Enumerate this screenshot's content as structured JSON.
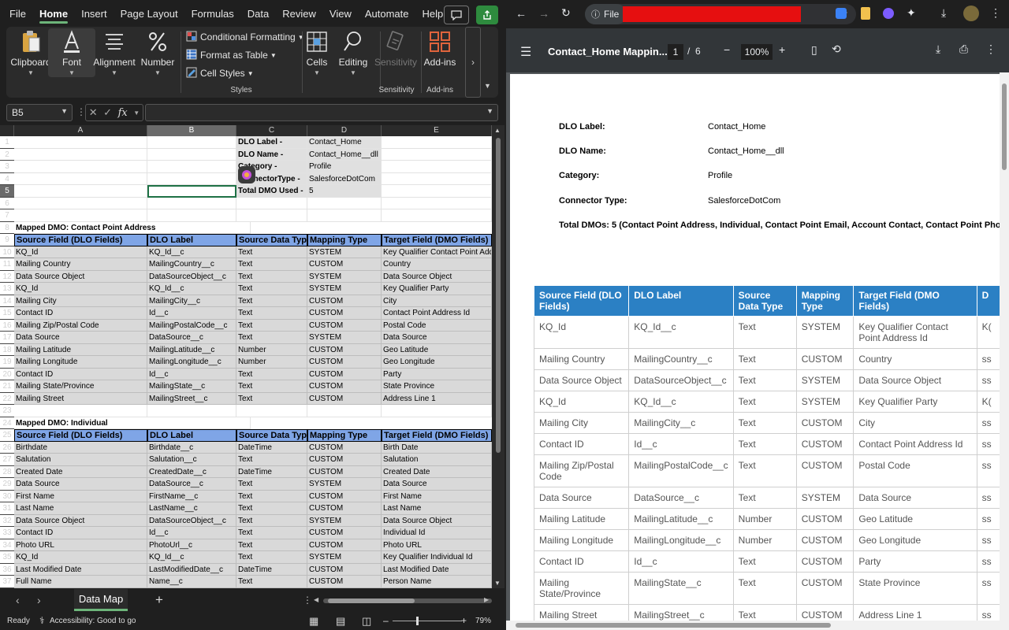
{
  "excel": {
    "tabs": [
      "File",
      "Home",
      "Insert",
      "Page Layout",
      "Formulas",
      "Data",
      "Review",
      "View",
      "Automate",
      "Help"
    ],
    "active_tab": "Home",
    "ribbon": {
      "clipboard": "Clipboard",
      "font": "Font",
      "alignment": "Alignment",
      "number": "Number",
      "conditional_formatting": "Conditional Formatting",
      "format_as_table": "Format as Table",
      "cell_styles": "Cell Styles",
      "styles_group": "Styles",
      "cells": "Cells",
      "editing": "Editing",
      "sensitivity": "Sensitivity",
      "sensitivity_group": "Sensitivity",
      "add_ins": "Add-ins",
      "add_ins_group": "Add-ins"
    },
    "name_box": "B5",
    "fx": "fx",
    "columns": [
      "A",
      "B",
      "C",
      "D",
      "E"
    ],
    "meta": [
      {
        "label": "DLO Label -",
        "value": "Contact_Home"
      },
      {
        "label": "DLO Name -",
        "value": "Contact_Home__dll"
      },
      {
        "label": "Category -",
        "value": "Profile"
      },
      {
        "label": "ConnectorType -",
        "value": "SalesforceDotCom"
      },
      {
        "label": "Total DMO Used -",
        "value": "5"
      }
    ],
    "section1_title": "Mapped DMO: Contact Point Address",
    "section2_title": "Mapped DMO: Individual",
    "table_headers": [
      "Source Field (DLO Fields)",
      "DLO Label",
      "Source Data Type",
      "Mapping Type",
      "Target Field (DMO Fields)"
    ],
    "section1_rows": [
      [
        "KQ_Id",
        "KQ_Id__c",
        "Text",
        "SYSTEM",
        "Key Qualifier Contact Point Address Id"
      ],
      [
        "Mailing Country",
        "MailingCountry__c",
        "Text",
        "CUSTOM",
        "Country"
      ],
      [
        "Data Source Object",
        "DataSourceObject__c",
        "Text",
        "SYSTEM",
        "Data Source Object"
      ],
      [
        "KQ_Id",
        "KQ_Id__c",
        "Text",
        "SYSTEM",
        "Key Qualifier Party"
      ],
      [
        "Mailing City",
        "MailingCity__c",
        "Text",
        "CUSTOM",
        "City"
      ],
      [
        "Contact ID",
        "Id__c",
        "Text",
        "CUSTOM",
        "Contact Point Address Id"
      ],
      [
        "Mailing Zip/Postal Code",
        "MailingPostalCode__c",
        "Text",
        "CUSTOM",
        "Postal Code"
      ],
      [
        "Data Source",
        "DataSource__c",
        "Text",
        "SYSTEM",
        "Data Source"
      ],
      [
        "Mailing Latitude",
        "MailingLatitude__c",
        "Number",
        "CUSTOM",
        "Geo Latitude"
      ],
      [
        "Mailing Longitude",
        "MailingLongitude__c",
        "Number",
        "CUSTOM",
        "Geo Longitude"
      ],
      [
        "Contact ID",
        "Id__c",
        "Text",
        "CUSTOM",
        "Party"
      ],
      [
        "Mailing State/Province",
        "MailingState__c",
        "Text",
        "CUSTOM",
        "State Province"
      ],
      [
        "Mailing Street",
        "MailingStreet__c",
        "Text",
        "CUSTOM",
        "Address Line 1"
      ]
    ],
    "section2_rows": [
      [
        "Birthdate",
        "Birthdate__c",
        "DateTime",
        "CUSTOM",
        "Birth Date"
      ],
      [
        "Salutation",
        "Salutation__c",
        "Text",
        "CUSTOM",
        "Salutation"
      ],
      [
        "Created Date",
        "CreatedDate__c",
        "DateTime",
        "CUSTOM",
        "Created Date"
      ],
      [
        "Data Source",
        "DataSource__c",
        "Text",
        "SYSTEM",
        "Data Source"
      ],
      [
        "First Name",
        "FirstName__c",
        "Text",
        "CUSTOM",
        "First Name"
      ],
      [
        "Last Name",
        "LastName__c",
        "Text",
        "CUSTOM",
        "Last Name"
      ],
      [
        "Data Source Object",
        "DataSourceObject__c",
        "Text",
        "SYSTEM",
        "Data Source Object"
      ],
      [
        "Contact ID",
        "Id__c",
        "Text",
        "CUSTOM",
        "Individual Id"
      ],
      [
        "Photo URL",
        "PhotoUrl__c",
        "Text",
        "CUSTOM",
        "Photo URL"
      ],
      [
        "KQ_Id",
        "KQ_Id__c",
        "Text",
        "SYSTEM",
        "Key Qualifier Individual Id"
      ],
      [
        "Last Modified Date",
        "LastModifiedDate__c",
        "DateTime",
        "CUSTOM",
        "Last Modified Date"
      ],
      [
        "Full Name",
        "Name__c",
        "Text",
        "CUSTOM",
        "Person Name"
      ]
    ],
    "sheet_tab": "Data Map",
    "status": {
      "ready": "Ready",
      "accessibility": "Accessibility: Good to go",
      "zoom": "79%"
    }
  },
  "browser": {
    "address_chip": "File",
    "pdf_title": "Contact_Home Mappin...",
    "page_current": "1",
    "page_sep": "/",
    "page_total": "6",
    "zoom": "100%",
    "meta": [
      {
        "label": "DLO Label:",
        "value": "Contact_Home"
      },
      {
        "label": "DLO Name:",
        "value": "Contact_Home__dll"
      },
      {
        "label": "Category:",
        "value": "Profile"
      },
      {
        "label": "Connector Type:",
        "value": "SalesforceDotCom"
      }
    ],
    "total_dmos": "Total DMOs: 5 (Contact Point Address, Individual, Contact Point Email, Account Contact, Contact Point Phone)",
    "table_headers": [
      "Source Field (DLO Fields)",
      "DLO Label",
      "Source Data Type",
      "Mapping Type",
      "Target Field (DMO Fields)",
      "D"
    ],
    "table_rows": [
      [
        "KQ_Id",
        "KQ_Id__c",
        "Text",
        "SYSTEM",
        "Key Qualifier Contact Point Address Id",
        "K("
      ],
      [
        "Mailing Country",
        "MailingCountry__c",
        "Text",
        "CUSTOM",
        "Country",
        "ss"
      ],
      [
        "Data Source Object",
        "DataSourceObject__c",
        "Text",
        "SYSTEM",
        "Data Source Object",
        "ss"
      ],
      [
        "KQ_Id",
        "KQ_Id__c",
        "Text",
        "SYSTEM",
        "Key Qualifier Party",
        "K("
      ],
      [
        "Mailing City",
        "MailingCity__c",
        "Text",
        "CUSTOM",
        "City",
        "ss"
      ],
      [
        "Contact ID",
        "Id__c",
        "Text",
        "CUSTOM",
        "Contact Point Address Id",
        "ss"
      ],
      [
        "Mailing Zip/Postal Code",
        "MailingPostalCode__c",
        "Text",
        "CUSTOM",
        "Postal Code",
        "ss"
      ],
      [
        "Data Source",
        "DataSource__c",
        "Text",
        "SYSTEM",
        "Data Source",
        "ss"
      ],
      [
        "Mailing Latitude",
        "MailingLatitude__c",
        "Number",
        "CUSTOM",
        "Geo Latitude",
        "ss"
      ],
      [
        "Mailing Longitude",
        "MailingLongitude__c",
        "Number",
        "CUSTOM",
        "Geo Longitude",
        "ss"
      ],
      [
        "Contact ID",
        "Id__c",
        "Text",
        "CUSTOM",
        "Party",
        "ss"
      ],
      [
        "Mailing State/Province",
        "MailingState__c",
        "Text",
        "CUSTOM",
        "State Province",
        "ss"
      ],
      [
        "Mailing Street",
        "MailingStreet__c",
        "Text",
        "CUSTOM",
        "Address Line 1",
        "ss"
      ]
    ]
  }
}
